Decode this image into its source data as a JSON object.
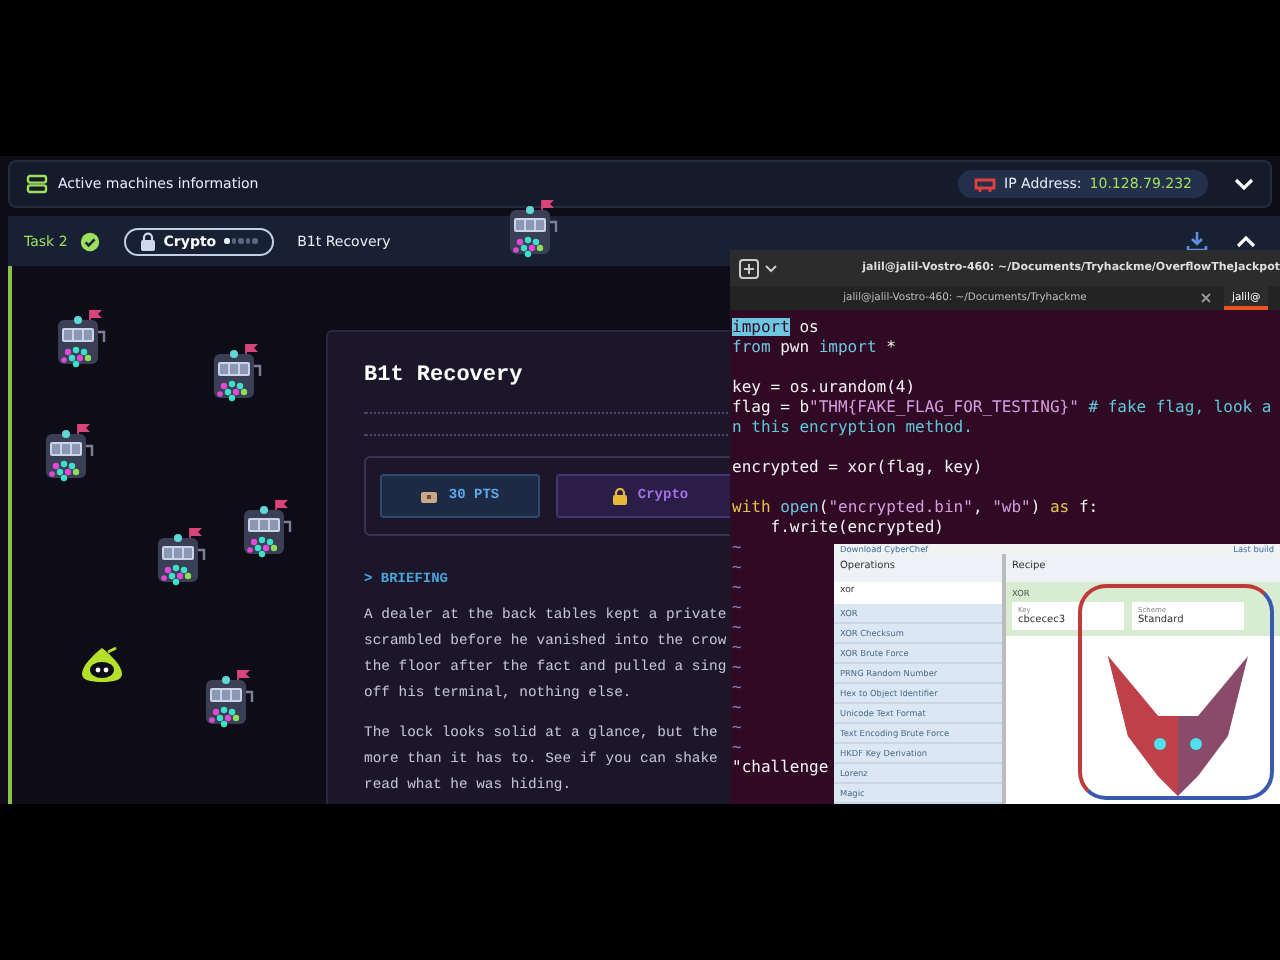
{
  "machines_bar": {
    "title": "Active machines information",
    "ip_label": "IP Address:",
    "ip": "10.128.79.232",
    "expanded": false
  },
  "task": {
    "label": "Task 2",
    "completed": true,
    "category": "Crypto",
    "stars": 1,
    "name": "B1t Recovery",
    "expanded": true
  },
  "challenge": {
    "title": "B1t Recovery",
    "points": "30 PTS",
    "category": "Crypto",
    "section": "> BRIEFING",
    "paragraphs": [
      [
        "A dealer at the back tables kept a private",
        "scrambled before he vanished into the crow",
        "the floor after the fact and pulled a sing",
        "off his terminal, nothing else."
      ],
      [
        "The lock looks solid at a glance, but the",
        "more than it has to. See if you can shake",
        "read what he was hiding."
      ]
    ]
  },
  "terminal": {
    "title": "jalil@jalil-Vostro-460: ~/Documents/Tryhackme/OverflowTheJackpot",
    "tabs": [
      {
        "label": "jalil@jalil-Vostro-460: ~/Documents/Tryhackme",
        "selected": false
      },
      {
        "label": "jalil@",
        "selected": true
      }
    ],
    "lines": [
      {
        "kind": "code",
        "segments": [
          {
            "kind": "keyword",
            "text": "import"
          },
          {
            "kind": "plain",
            "text": " os"
          }
        ]
      },
      {
        "kind": "code",
        "segments": [
          {
            "kind": "keyword",
            "text": "from"
          },
          {
            "kind": "plain",
            "text": " pwn "
          },
          {
            "kind": "keyword",
            "text": "import"
          },
          {
            "kind": "plain",
            "text": " *"
          }
        ]
      },
      {
        "kind": "blank"
      },
      {
        "kind": "code",
        "segments": [
          {
            "kind": "plain",
            "text": "key = os.urandom(4)"
          }
        ]
      },
      {
        "kind": "code",
        "segments": [
          {
            "kind": "plain",
            "text": "flag = b"
          },
          {
            "kind": "string",
            "text": "\"THM{FAKE_FLAG_FOR_TESTING}\""
          },
          {
            "kind": "comment",
            "text": " # fake flag, look a"
          }
        ]
      },
      {
        "kind": "code",
        "segments": [
          {
            "kind": "comment",
            "text": "n this encryption method."
          }
        ]
      },
      {
        "kind": "blank"
      },
      {
        "kind": "code",
        "segments": [
          {
            "kind": "plain",
            "text": "encrypted = xor(flag, key)"
          }
        ]
      },
      {
        "kind": "blank"
      },
      {
        "kind": "code",
        "segments": [
          {
            "kind": "control",
            "text": "with"
          },
          {
            "kind": "keyword",
            "text": " open"
          },
          {
            "kind": "plain",
            "text": "("
          },
          {
            "kind": "string",
            "text": "\"encrypted.bin\""
          },
          {
            "kind": "plain",
            "text": ", "
          },
          {
            "kind": "string",
            "text": "\"wb\""
          },
          {
            "kind": "plain",
            "text": ") "
          },
          {
            "kind": "control",
            "text": "as"
          },
          {
            "kind": "plain",
            "text": " f:"
          }
        ]
      },
      {
        "kind": "code",
        "segments": [
          {
            "kind": "plain",
            "text": "    f.write(encrypted)"
          }
        ]
      },
      {
        "kind": "tilde",
        "text": "~"
      },
      {
        "kind": "tilde",
        "text": "~"
      },
      {
        "kind": "tilde",
        "text": "~"
      },
      {
        "kind": "tilde",
        "text": "~"
      },
      {
        "kind": "tilde",
        "text": "~"
      },
      {
        "kind": "tilde",
        "text": "~"
      },
      {
        "kind": "tilde",
        "text": "~"
      },
      {
        "kind": "tilde",
        "text": "~"
      },
      {
        "kind": "tilde",
        "text": "~"
      },
      {
        "kind": "tilde",
        "text": "~"
      },
      {
        "kind": "tilde",
        "text": "~"
      },
      {
        "kind": "code",
        "segments": [
          {
            "kind": "plain",
            "text": "\"challenge"
          }
        ]
      }
    ]
  },
  "cyberchef": {
    "download": "Download CyberChef",
    "last_build": "Last build",
    "operations_title": "Operations",
    "search": "xor",
    "operations": [
      "XOR",
      "XOR Checksum",
      "XOR Brute Force",
      "PRNG Random Number",
      "Hex to Object Identifier",
      "Unicode Text Format",
      "Text Encoding Brute Force",
      "HKDF Key Derivation",
      "Lorenz",
      "Magic"
    ],
    "recipe_title": "Recipe",
    "operation": "XOR",
    "key_label": "Key",
    "key_value": "cbcecec3",
    "scheme_label": "Scheme",
    "scheme_value": "Standard"
  }
}
